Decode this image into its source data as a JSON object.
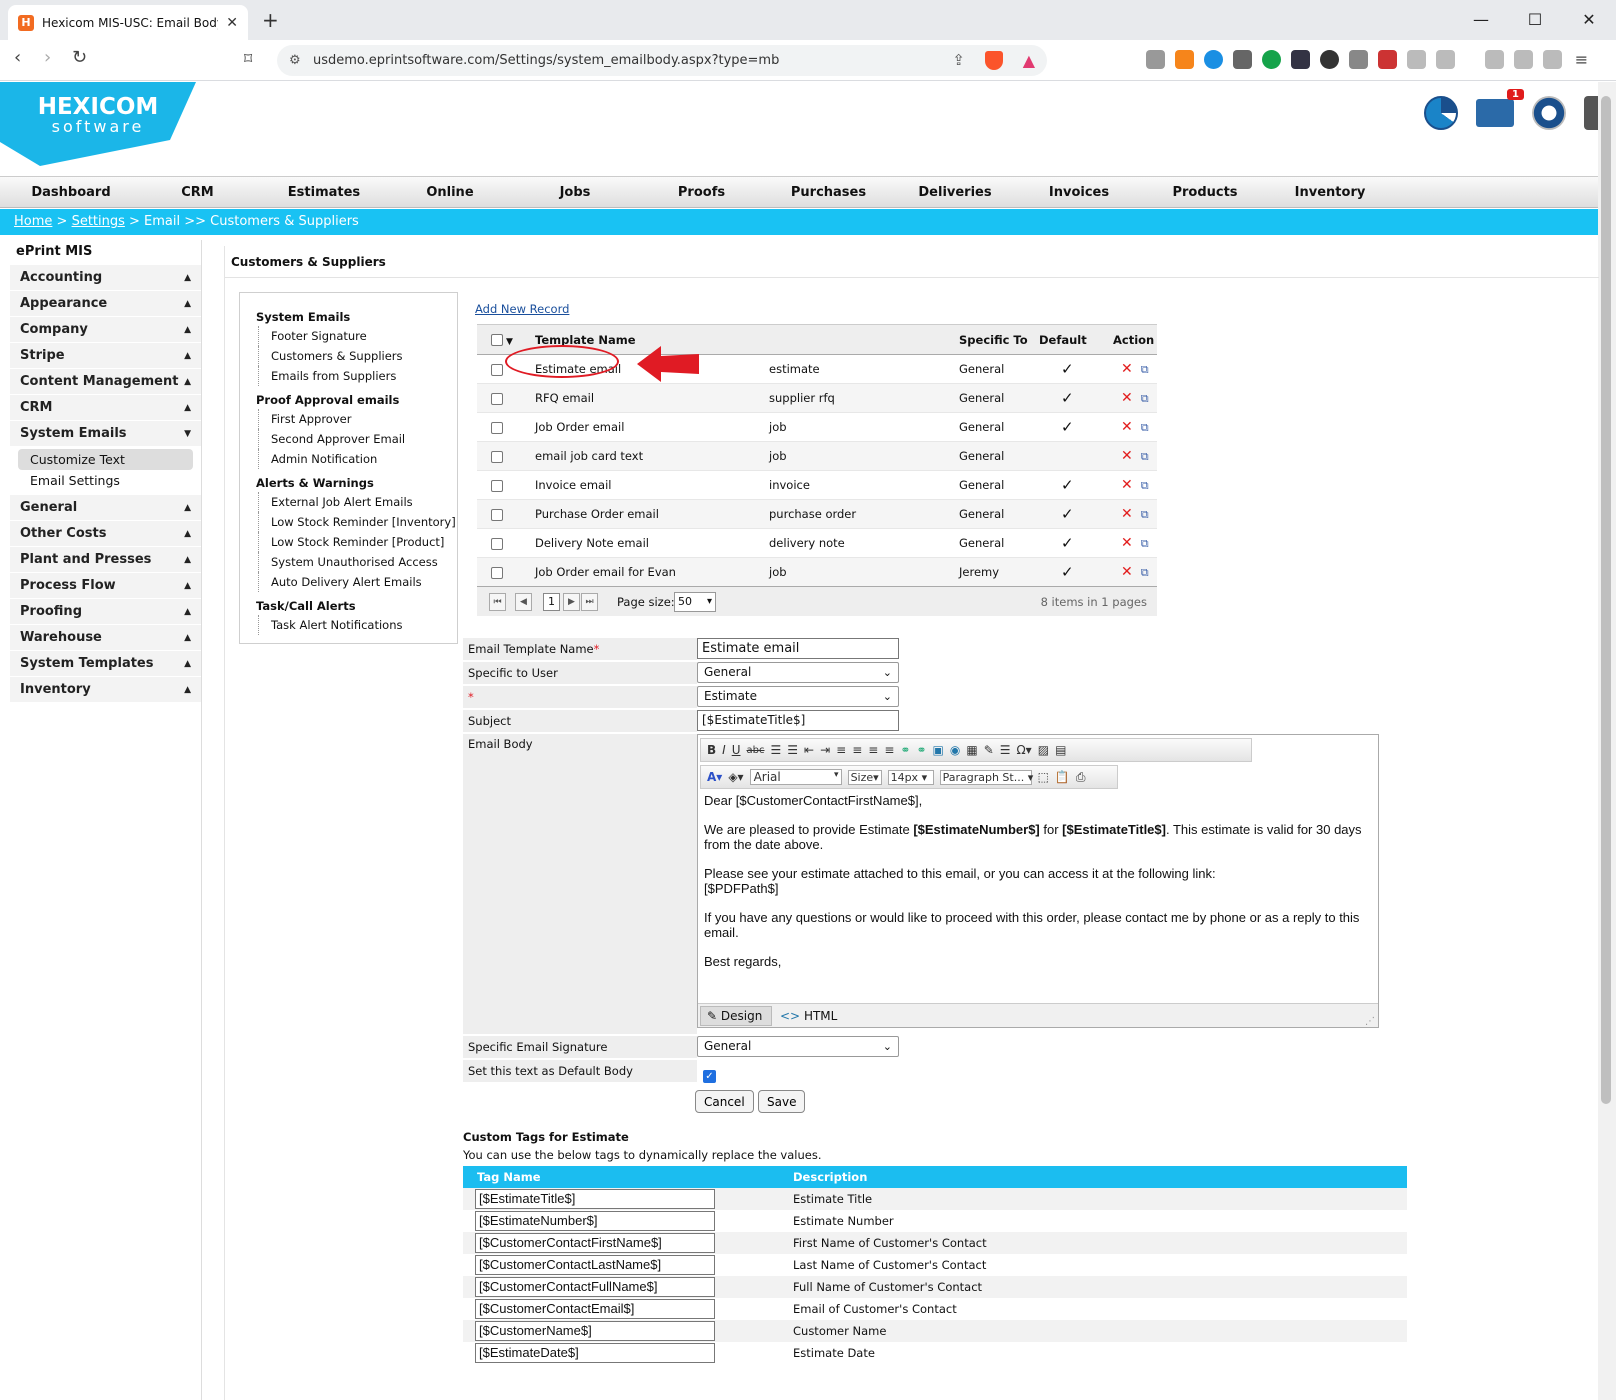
{
  "browser": {
    "tab_title": "Hexicom MIS-USC: Email Body",
    "url": "usdemo.eprintsoftware.com/Settings/system_emailbody.aspx?type=mb"
  },
  "header": {
    "logo_line1": "HEXICOM",
    "logo_line2": "software",
    "mail_badge": "1"
  },
  "nav": [
    "Dashboard",
    "CRM",
    "Estimates",
    "Online Orders",
    "Jobs",
    "Proofs",
    "Purchases",
    "Deliveries",
    "Invoices",
    "Products",
    "Inventory"
  ],
  "breadcrumb": {
    "home": "Home",
    "sep1": " > ",
    "settings": "Settings",
    "rest": " > Email >> Customers & Suppliers"
  },
  "sidebar": {
    "brand": "ePrint MIS",
    "sections_top": [
      "Accounting",
      "Appearance",
      "Company",
      "Stripe",
      "Content Management",
      "CRM",
      "System Emails"
    ],
    "sub": [
      "Customize Text",
      "Email Settings"
    ],
    "sections_bottom": [
      "General",
      "Other Costs",
      "Plant and Presses",
      "Process Flow",
      "Proofing",
      "Warehouse",
      "System Templates",
      "Inventory"
    ]
  },
  "content_title": "Customers & Suppliers",
  "tree": {
    "groups": [
      {
        "title": "System Emails",
        "items": [
          "Footer Signature",
          "Customers & Suppliers",
          "Emails from Suppliers"
        ]
      },
      {
        "title": "Proof Approval emails",
        "items": [
          "First Approver",
          "Second Approver Email",
          "Admin Notification"
        ]
      },
      {
        "title": "Alerts & Warnings",
        "items": [
          "External Job Alert Emails",
          "Low Stock Reminder [Inventory]",
          "Low Stock Reminder [Product]",
          "System Unauthorised Access",
          "Auto Delivery Alert Emails"
        ]
      },
      {
        "title": "Task/Call Alerts",
        "items": [
          "Task Alert Notifications"
        ]
      }
    ]
  },
  "grid": {
    "add_new": "Add New Record",
    "columns": {
      "name": "Template Name",
      "specific": "Specific To",
      "default": "Default",
      "action": "Action"
    },
    "rows": [
      {
        "name": "Estimate email",
        "type": "estimate",
        "specific": "General",
        "default": "✓"
      },
      {
        "name": "RFQ email",
        "type": "supplier rfq",
        "specific": "General",
        "default": "✓"
      },
      {
        "name": "Job Order email",
        "type": "job",
        "specific": "General",
        "default": "✓"
      },
      {
        "name": "email job card text",
        "type": "job",
        "specific": "General",
        "default": ""
      },
      {
        "name": "Invoice email",
        "type": "invoice",
        "specific": "General",
        "default": "✓"
      },
      {
        "name": "Purchase Order email",
        "type": "purchase order",
        "specific": "General",
        "default": "✓"
      },
      {
        "name": "Delivery Note email",
        "type": "delivery note",
        "specific": "General",
        "default": "✓"
      },
      {
        "name": "Job Order email for Evan",
        "type": "job",
        "specific": "Jeremy",
        "default": "✓"
      }
    ],
    "pager": {
      "page": "1",
      "size_label": "Page size:",
      "size": "50",
      "info": "8 items in 1 pages"
    }
  },
  "form": {
    "template_name_label": "Email Template Name",
    "required_mark": "*",
    "template_name_value": "Estimate email",
    "specific_user_label": "Specific to User",
    "specific_user_value": "General",
    "type_value": "Estimate",
    "subject_label": "Subject",
    "subject_value": "[$EstimateTitle$]",
    "body_label": "Email Body",
    "signature_label": "Specific Email Signature",
    "signature_value": "General",
    "default_label": "Set this text as Default Body",
    "cancel": "Cancel",
    "save": "Save"
  },
  "editor": {
    "font": "Arial",
    "size": "Size",
    "px": "14px",
    "para": "Paragraph St...",
    "design_tab": "Design",
    "html_tab": "HTML",
    "body": {
      "l1": "Dear [$CustomerContactFirstName$],",
      "l2a": "We are pleased to provide Estimate ",
      "l2b": "[$EstimateNumber$]",
      "l2c": " for ",
      "l2d": "[$EstimateTitle$]",
      "l2e": ". This estimate is valid for 30 days from the date above.",
      "l3": "Please see your estimate attached to this email, or you can access it at the following link:",
      "l3b": "[$PDFPath$]",
      "l4": "If you have any questions or would like to proceed with this order, please contact me by phone or as a reply to this email.",
      "l5": "Best regards,"
    }
  },
  "custom_tags": {
    "title": "Custom Tags for Estimate",
    "subtitle": "You can use the below tags to dynamically replace the values.",
    "col_tag": "Tag Name",
    "col_desc": "Description",
    "rows": [
      {
        "tag": "[$EstimateTitle$]",
        "desc": "Estimate Title"
      },
      {
        "tag": "[$EstimateNumber$]",
        "desc": "Estimate Number"
      },
      {
        "tag": "[$CustomerContactFirstName$]",
        "desc": "First Name of Customer's Contact"
      },
      {
        "tag": "[$CustomerContactLastName$]",
        "desc": "Last Name of Customer's Contact"
      },
      {
        "tag": "[$CustomerContactFullName$]",
        "desc": "Full Name of Customer's Contact"
      },
      {
        "tag": "[$CustomerContactEmail$]",
        "desc": "Email of Customer's Contact"
      },
      {
        "tag": "[$CustomerName$]",
        "desc": "Customer Name"
      },
      {
        "tag": "[$EstimateDate$]",
        "desc": "Estimate Date"
      }
    ]
  },
  "colors": {
    "accent": "#19c2f3",
    "logo": "#1bb6e8",
    "danger": "#e01b24"
  }
}
